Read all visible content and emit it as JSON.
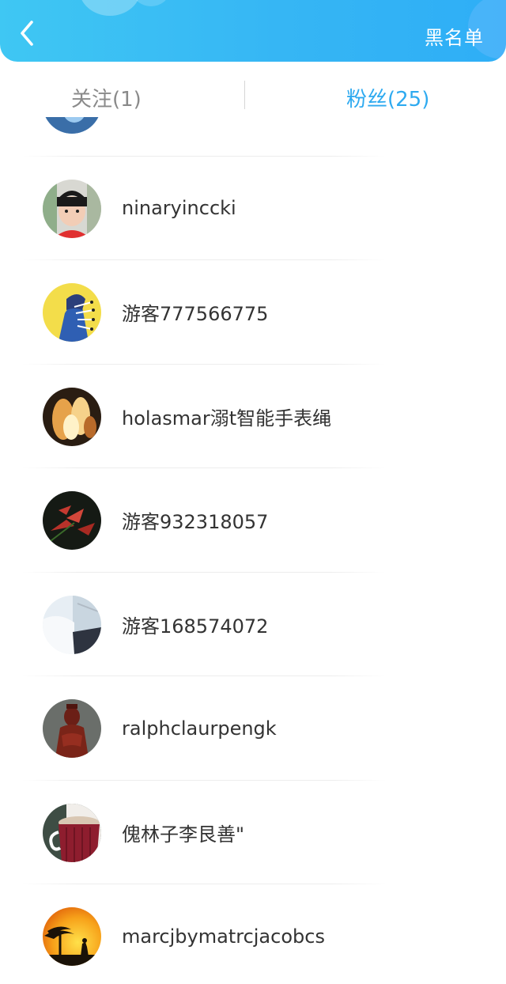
{
  "header": {
    "back_icon": "chevron-left-icon",
    "blacklist_label": "黑名单",
    "background_color": "#36b6f4"
  },
  "tabs": {
    "follow_label": "关注(1)",
    "fans_label": "粉丝(25)",
    "active_color": "#2eaaf0",
    "inactive_color": "#8a8a8a"
  },
  "fans": [
    {
      "name": "",
      "avatar": "blue-photo-avatar"
    },
    {
      "name": "ninaryinccki",
      "avatar": "child-photo-avatar"
    },
    {
      "name": "游客777566775",
      "avatar": "cartoon-avatar"
    },
    {
      "name": "holasmar溺t智能手表绳",
      "avatar": "fire-photo-avatar"
    },
    {
      "name": "游客932318057",
      "avatar": "flower-photo-avatar"
    },
    {
      "name": "游客168574072",
      "avatar": "snow-photo-avatar"
    },
    {
      "name": "ralphclaurpengk",
      "avatar": "statue-photo-avatar"
    },
    {
      "name": "傀林子李艮善\"",
      "avatar": "cup-photo-avatar"
    },
    {
      "name": "marcjbymatrcjacobcs",
      "avatar": "sunset-tree-avatar"
    }
  ]
}
